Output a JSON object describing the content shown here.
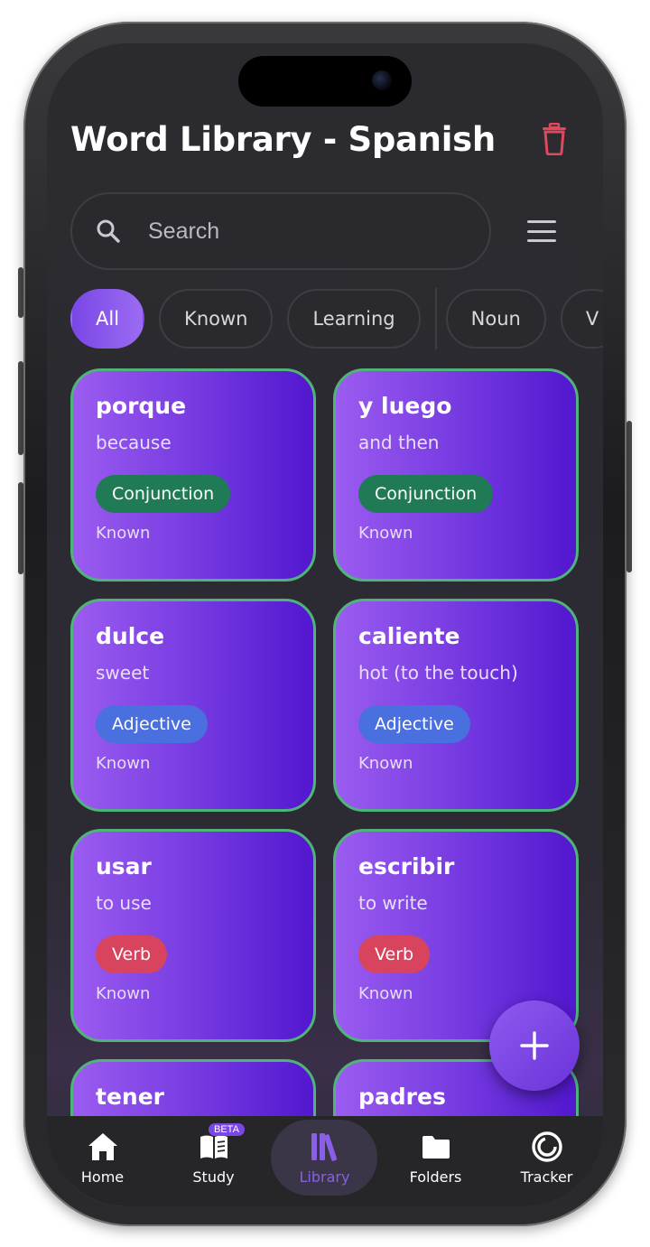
{
  "header": {
    "title": "Word Library - Spanish"
  },
  "search": {
    "placeholder": "Search"
  },
  "filters": [
    {
      "label": "All",
      "active": true
    },
    {
      "label": "Known"
    },
    {
      "label": "Learning"
    },
    {
      "label": "Noun"
    },
    {
      "label": "V"
    }
  ],
  "cards": [
    {
      "word": "porque",
      "meaning": "because",
      "pos": "Conjunction",
      "pos_color": "#1f7a55",
      "status": "Known"
    },
    {
      "word": "y luego",
      "meaning": "and then",
      "pos": "Conjunction",
      "pos_color": "#1f7a55",
      "status": "Known"
    },
    {
      "word": "dulce",
      "meaning": "sweet",
      "pos": "Adjective",
      "pos_color": "#4a6fde",
      "status": "Known"
    },
    {
      "word": "caliente",
      "meaning": "hot (to the touch)",
      "pos": "Adjective",
      "pos_color": "#4a6fde",
      "status": "Known"
    },
    {
      "word": "usar",
      "meaning": "to use",
      "pos": "Verb",
      "pos_color": "#d8435e",
      "status": "Known"
    },
    {
      "word": "escribir",
      "meaning": "to write",
      "pos": "Verb",
      "pos_color": "#d8435e",
      "status": "Known"
    },
    {
      "word": "tener",
      "meaning": "",
      "pos": "",
      "pos_color": "",
      "status": ""
    },
    {
      "word": "padres",
      "meaning": "",
      "pos": "",
      "pos_color": "",
      "status": ""
    }
  ],
  "tabs": [
    {
      "label": "Home",
      "icon": "home-icon"
    },
    {
      "label": "Study",
      "icon": "book-icon",
      "badge": "BETA"
    },
    {
      "label": "Library",
      "icon": "library-icon",
      "active": true
    },
    {
      "label": "Folders",
      "icon": "folder-icon"
    },
    {
      "label": "Tracker",
      "icon": "tracker-icon"
    }
  ],
  "colors": {
    "accent": "#7b46e6",
    "card_border": "#4fb37a",
    "danger": "#e0485e"
  }
}
